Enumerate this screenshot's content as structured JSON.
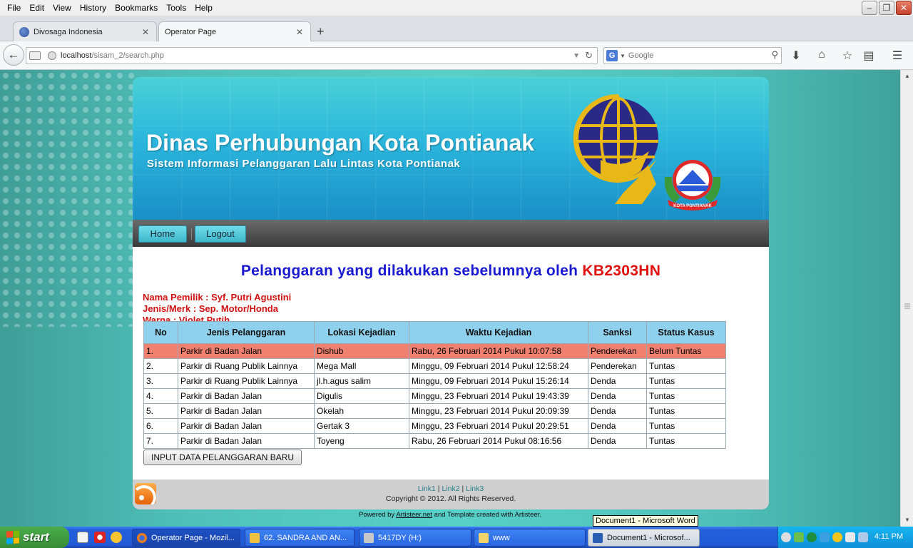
{
  "browser": {
    "menu": [
      "File",
      "Edit",
      "View",
      "History",
      "Bookmarks",
      "Tools",
      "Help"
    ],
    "tabs": [
      {
        "label": "Divosaga Indonesia"
      },
      {
        "label": "Operator Page"
      }
    ],
    "new_tab": "+",
    "url_host": "localhost",
    "url_path": "/sisam_2/search.php",
    "search_placeholder": "Google",
    "search_engine_icon": "G"
  },
  "page": {
    "site_title": "Dinas Perhubungan Kota Pontianak",
    "site_subtitle": "Sistem Informasi Pelanggaran Lalu Lintas Kota Pontianak",
    "logo_text": "KOTA PONTIANAK",
    "nav": {
      "home": "Home",
      "logout": "Logout"
    },
    "heading_prefix": "Pelanggaran yang dilakukan sebelumnya oleh",
    "plate": "KB2303HN",
    "owner": "Nama Pemilik : Syf. Putri Agustini",
    "vehicle": "Jenis/Merk : Sep. Motor/Honda",
    "color": "Warna : Violet Putih",
    "table": {
      "headers": [
        "No",
        "Jenis Pelanggaran",
        "Lokasi Kejadian",
        "Waktu Kejadian",
        "Sanksi",
        "Status Kasus"
      ],
      "rows": [
        [
          "1.",
          "Parkir di Badan Jalan",
          "Dishub",
          "Rabu, 26 Februari 2014 Pukul 10:07:58",
          "Penderekan",
          "Belum Tuntas"
        ],
        [
          "2.",
          "Parkir di Ruang Publik Lainnya",
          "Mega Mall",
          "Minggu, 09 Februari 2014 Pukul 12:58:24",
          "Penderekan",
          "Tuntas"
        ],
        [
          "3.",
          "Parkir di Ruang Publik Lainnya",
          "jl.h.agus salim",
          "Minggu, 09 Februari 2014 Pukul 15:26:14",
          "Denda",
          "Tuntas"
        ],
        [
          "4.",
          "Parkir di Badan Jalan",
          "Digulis",
          "Minggu, 23 Februari 2014 Pukul 19:43:39",
          "Denda",
          "Tuntas"
        ],
        [
          "5.",
          "Parkir di Badan Jalan",
          "Okelah",
          "Minggu, 23 Februari 2014 Pukul 20:09:39",
          "Denda",
          "Tuntas"
        ],
        [
          "6.",
          "Parkir di Badan Jalan",
          "Gertak 3",
          "Minggu, 23 Februari 2014 Pukul 20:29:51",
          "Denda",
          "Tuntas"
        ],
        [
          "7.",
          "Parkir di Badan Jalan",
          "Toyeng",
          "Rabu, 26 Februari 2014 Pukul 08:16:56",
          "Denda",
          "Tuntas"
        ]
      ],
      "highlight_color": "#f08070"
    },
    "add_button": "INPUT DATA PELANGGARAN BARU",
    "footer": {
      "link1": "Link1",
      "link2": "Link2",
      "link3": "Link3",
      "sep": "|",
      "copyright": "Copyright © 2012. All Rights Reserved.",
      "powered_prefix": "Powered by",
      "powered_link": "Artisteer.net",
      "powered_suffix": "and Template created with Artisteer."
    }
  },
  "tooltip": "Document1 - Microsoft Word",
  "taskbar": {
    "start": "start",
    "tasks": [
      {
        "label": "Operator Page - Mozil...",
        "icon": "firefox-icon"
      },
      {
        "label": "62. SANDRA AND AN...",
        "icon": "pencil-icon"
      },
      {
        "label": "5417DY (H:)",
        "icon": "drive-icon"
      },
      {
        "label": "www",
        "icon": "folder-icon"
      },
      {
        "label": "Document1 - Microsof...",
        "icon": "word-icon"
      }
    ],
    "clock": "4:11 PM"
  },
  "colors": {
    "heading_blue": "#1a1ad0",
    "plate_red": "#e01010",
    "info_red": "#d01010",
    "table_header": "#8fd0ed",
    "nav_button": "#4fc5d8",
    "page_bg": "#4fc0b9"
  }
}
